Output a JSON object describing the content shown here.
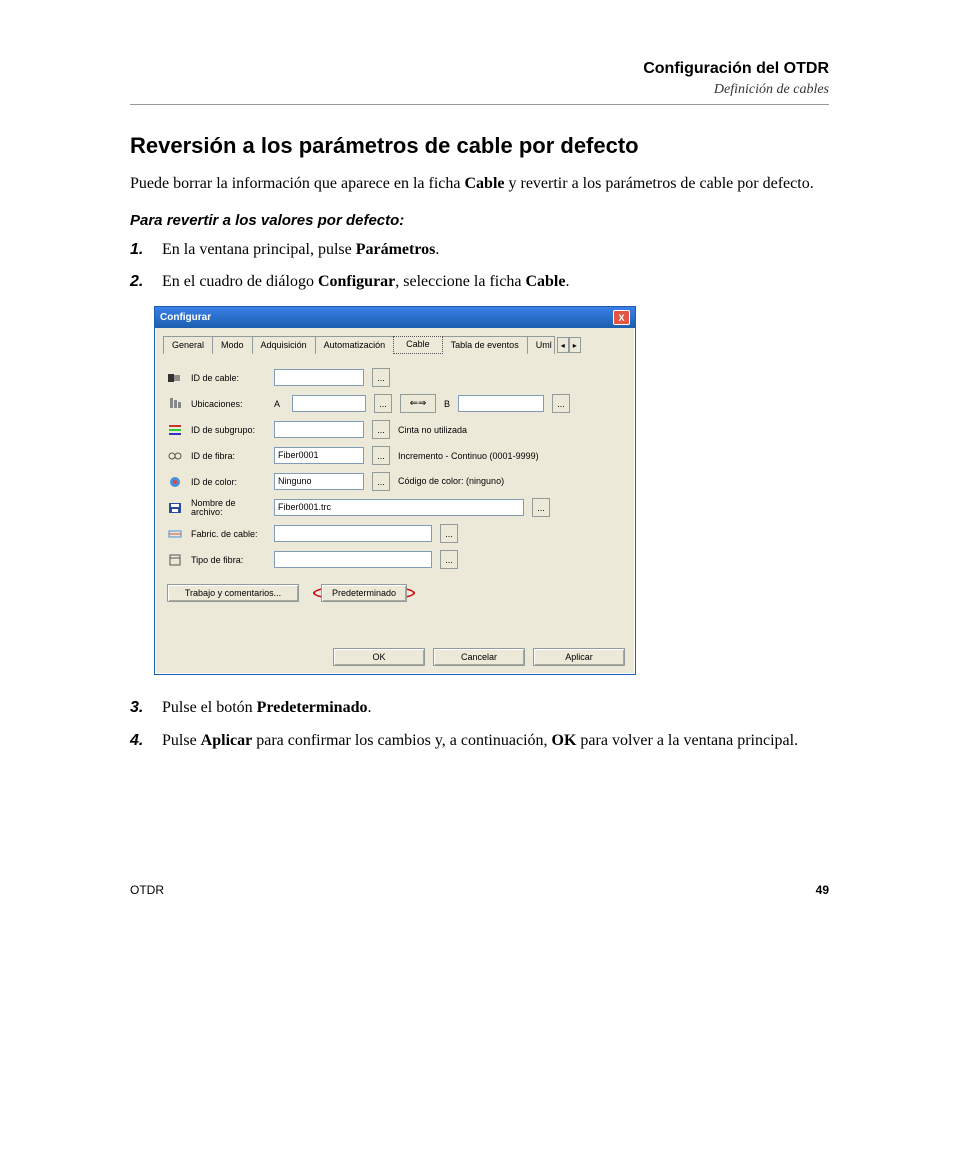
{
  "header": {
    "title": "Configuración del OTDR",
    "subtitle": "Definición de cables"
  },
  "section_title": "Reversión a los parámetros de cable por defecto",
  "intro": {
    "part1": "Puede borrar la información que aparece en la ficha ",
    "bold1": "Cable",
    "part2": " y revertir a los parámetros de cable por defecto."
  },
  "subheading": "Para revertir a los valores por defecto:",
  "steps": {
    "s1": {
      "num": "1.",
      "a": "En la ventana principal, pulse ",
      "b": "Parámetros",
      "c": "."
    },
    "s2": {
      "num": "2.",
      "a": "En el cuadro de diálogo ",
      "b": "Configurar",
      "c": ", seleccione la ficha ",
      "d": "Cable",
      "e": "."
    },
    "s3": {
      "num": "3.",
      "a": "Pulse el botón ",
      "b": "Predeterminado",
      "c": "."
    },
    "s4": {
      "num": "4.",
      "a": "Pulse ",
      "b": "Aplicar",
      "c": " para confirmar los cambios y, a continuación, ",
      "d": "OK",
      "e": " para volver a la ventana principal."
    }
  },
  "dialog": {
    "title": "Configurar",
    "close": "X",
    "tabs": {
      "general": "General",
      "modo": "Modo",
      "adquisicion": "Adquisición",
      "automatizacion": "Automatización",
      "cable": "Cable",
      "tabla": "Tabla de eventos",
      "umb": "Uml",
      "left_arrow": "◂",
      "right_arrow": "▸"
    },
    "rows": {
      "cable_id_label": "ID de cable:",
      "ubicaciones_label": "Ubicaciones:",
      "ubic_A": "A",
      "ubic_B": "B",
      "subgrupo_label": "ID de subgrupo:",
      "cinta": "Cinta no utilizada",
      "fibra_label": "ID de fibra:",
      "fibra_value": "Fiber0001",
      "incremento": "Incremento - Continuo (0001-9999)",
      "color_label": "ID de color:",
      "color_value": "Ninguno",
      "codigo_color": "Código de color: (ninguno)",
      "archivo_label": "Nombre de archivo:",
      "archivo_value": "Fiber0001.trc",
      "fabric_label": "Fabric. de cable:",
      "tipofibra_label": "Tipo de fibra:",
      "arrows": "⇐⇒",
      "dots": "..."
    },
    "btn_trabajo": "Trabajo y comentarios...",
    "btn_predet": "Predeterminado",
    "btn_ok": "OK",
    "btn_cancel": "Cancelar",
    "btn_aplicar": "Aplicar"
  },
  "footer": {
    "left": "OTDR",
    "right": "49"
  }
}
